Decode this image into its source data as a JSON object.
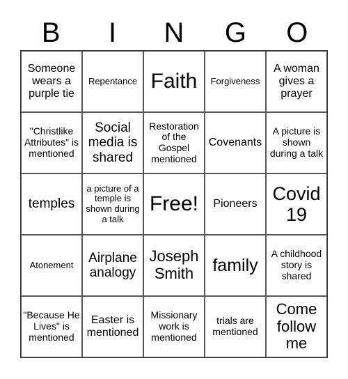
{
  "title_letters": [
    "B",
    "I",
    "N",
    "G",
    "O"
  ],
  "cells": [
    [
      "Someone wears a purple tie",
      "Repentance",
      "Faith",
      "Forgiveness",
      "A woman gives a prayer"
    ],
    [
      "\"Christlike Attributes\" is mentioned",
      "Social media is shared",
      "Restoration of the Gospel mentioned",
      "Covenants",
      "A picture is shown during a talk"
    ],
    [
      "temples",
      "a picture of a temple is shown during a talk",
      "Free!",
      "Pioneers",
      "Covid 19"
    ],
    [
      "Atonement",
      "Airplane analogy",
      "Joseph Smith",
      "family",
      "A childhood story is shared"
    ],
    [
      "\"Because He Lives\" is mentioned",
      "Easter is mentioned",
      "Missionary work is mentioned",
      "trials are mentioned",
      "Come follow me"
    ]
  ]
}
